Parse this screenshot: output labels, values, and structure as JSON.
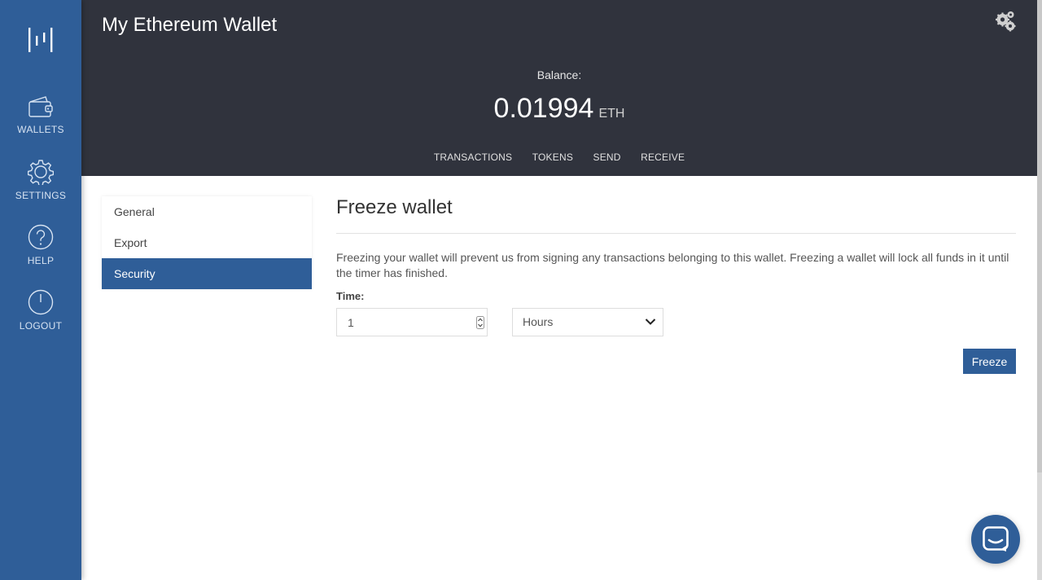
{
  "colors": {
    "sidebar_bg": "#2f5e98",
    "header_bg": "#30333d",
    "accent": "#2f5e98"
  },
  "sidebar": {
    "logo_icon": "bitgo-logo-icon",
    "items": [
      {
        "label": "WALLETS",
        "icon": "wallet-icon"
      },
      {
        "label": "SETTINGS",
        "icon": "gear-icon"
      },
      {
        "label": "HELP",
        "icon": "question-circle-icon"
      },
      {
        "label": "LOGOUT",
        "icon": "power-icon"
      }
    ]
  },
  "header": {
    "title": "My Ethereum Wallet",
    "settings_icon": "gears-icon",
    "balance_label": "Balance:",
    "balance_amount": "0.01994",
    "balance_unit": "ETH",
    "tabs": [
      "TRANSACTIONS",
      "TOKENS",
      "SEND",
      "RECEIVE"
    ]
  },
  "submenu": {
    "items": [
      "General",
      "Export",
      "Security"
    ],
    "active": "Security"
  },
  "main": {
    "title": "Freeze wallet",
    "description": "Freezing your wallet will prevent us from signing any transactions belonging to this wallet. Freezing a wallet will lock all funds in it until the timer has finished.",
    "time_label": "Time:",
    "time_value": "1",
    "unit_selected": "Hours",
    "freeze_button": "Freeze"
  },
  "chat": {
    "icon": "chat-icon"
  }
}
